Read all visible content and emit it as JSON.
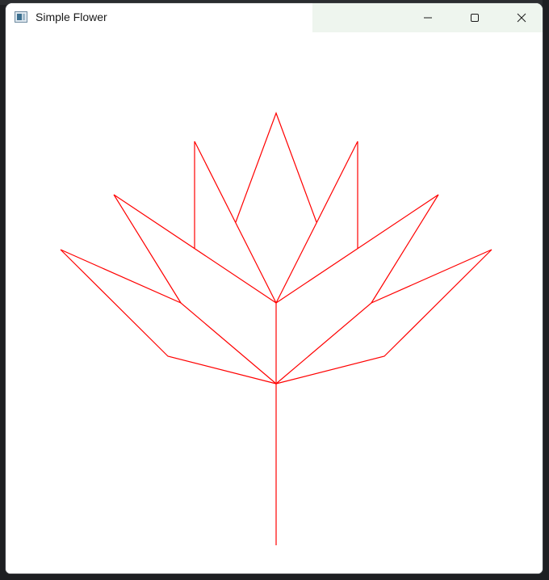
{
  "window": {
    "title": "Simple Flower",
    "icon": "app-window-icon",
    "controls": {
      "minimize": "minimize-icon",
      "maximize": "maximize-icon",
      "close": "close-icon"
    }
  },
  "drawing": {
    "stroke_color": "#ff0000",
    "background_color": "#ffffff"
  }
}
